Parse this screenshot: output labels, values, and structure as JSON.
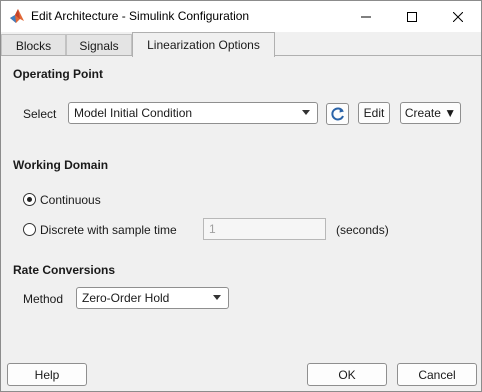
{
  "window": {
    "title": "Edit Architecture - Simulink Configuration"
  },
  "tabs": [
    {
      "label": "Blocks",
      "active": false
    },
    {
      "label": "Signals",
      "active": false
    },
    {
      "label": "Linearization Options",
      "active": true
    }
  ],
  "operating_point": {
    "section_title": "Operating Point",
    "select_label": "Select",
    "selected_value": "Model Initial Condition",
    "refresh_icon": "refresh-icon",
    "edit_label": "Edit",
    "create_label": "Create ▼"
  },
  "working_domain": {
    "section_title": "Working Domain",
    "continuous_label": "Continuous",
    "continuous_selected": true,
    "discrete_label": "Discrete with sample time",
    "discrete_selected": false,
    "sample_time_value": "1",
    "seconds_label": "(seconds)"
  },
  "rate_conversions": {
    "section_title": "Rate Conversions",
    "method_label": "Method",
    "method_value": "Zero-Order Hold"
  },
  "footer": {
    "help_label": "Help",
    "ok_label": "OK",
    "cancel_label": "Cancel"
  },
  "colors": {
    "background": "#f0f0f0",
    "titlebar": "#ffffff",
    "border": "#8f8f8f"
  }
}
